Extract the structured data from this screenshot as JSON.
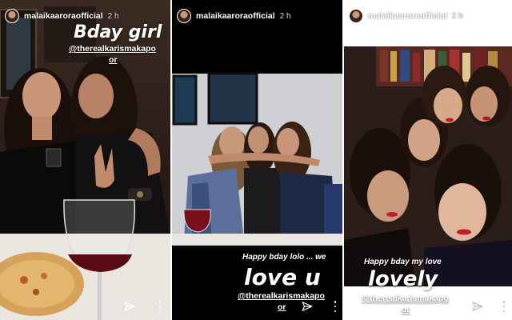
{
  "colors": {
    "text": "#ffffff",
    "panel_background": "#000000",
    "lip_red": "#c01c2c"
  },
  "icons": [
    "send-icon",
    "more-options-icon"
  ],
  "stories": [
    {
      "username": "malaikaaroraofficial",
      "time_ago": "2 h",
      "sticker_text": "Bday girl",
      "mention_line1": "@therealkarismakapo",
      "mention_line2": "or"
    },
    {
      "username": "malaikaaroraofficial",
      "time_ago": "2 h",
      "caption_text": "Happy bday lolo ... we",
      "sticker_text": "love u",
      "mention_line1": "@therealkarismakapo",
      "mention_line2": "or"
    },
    {
      "username": "malaikaaroraofficial",
      "time_ago": "2 h",
      "caption_text": "Happy bday my love",
      "sticker_text": "lovely",
      "mention_line1": "@therealkarismakapo",
      "mention_line2": "or"
    }
  ]
}
